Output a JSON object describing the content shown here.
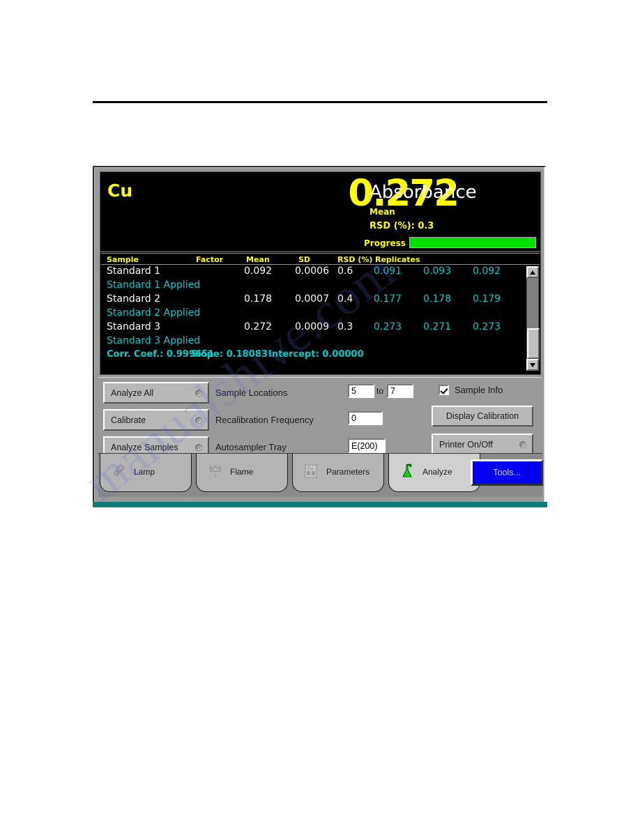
{
  "window": {
    "title": "Analyze"
  },
  "readout": {
    "element": "Cu",
    "value": "0.272",
    "unit": "Absorbance",
    "mean_label": "Mean",
    "rsd_label": "RSD (%): 0.3",
    "progress_label": "Progress",
    "progress_percent": 100,
    "value_color": "#ffff00",
    "unit_color": "#ffffff",
    "progress_color": "#00e000",
    "background_color": "#000000"
  },
  "results_table": {
    "columns": [
      "Sample",
      "Factor",
      "Mean",
      "SD",
      "RSD (%)",
      "Replicates"
    ],
    "header_color": "#ffff00",
    "rule_color": "#00cccc",
    "rows": [
      {
        "type": "data",
        "name": "Standard 1",
        "factor": "",
        "mean": "0.092",
        "sd": "0.0006",
        "rsd": "0.6",
        "replicates": [
          "0.091",
          "0.093",
          "0.092"
        ]
      },
      {
        "type": "status",
        "name": "Standard 1 Applied"
      },
      {
        "type": "data",
        "name": "Standard 2",
        "factor": "",
        "mean": "0.178",
        "sd": "0.0007",
        "rsd": "0.4",
        "replicates": [
          "0.177",
          "0.178",
          "0.179"
        ]
      },
      {
        "type": "status",
        "name": "Standard 2 Applied"
      },
      {
        "type": "data",
        "name": "Standard 3",
        "factor": "",
        "mean": "0.272",
        "sd": "0.0009",
        "rsd": "0.3",
        "replicates": [
          "0.273",
          "0.271",
          "0.273"
        ]
      },
      {
        "type": "status",
        "name": "Standard 3 Applied"
      }
    ],
    "statistics": {
      "corr_coef": "Corr. Coef.: 0.999651",
      "slope": "Slope: 0.18083",
      "intercept": "Intercept: 0.00000"
    }
  },
  "controls": {
    "buttons": [
      {
        "label": "Analyze All"
      },
      {
        "label": "Calibrate"
      },
      {
        "label": "Analyze Samples"
      }
    ],
    "fields": [
      {
        "label": "Sample Locations",
        "from": "5",
        "connector": "to",
        "to": "7"
      },
      {
        "label": "Recalibration Frequency",
        "value": "0"
      },
      {
        "label": "Autosampler Tray",
        "value": "E(200)"
      }
    ],
    "sample_info": {
      "label": "Sample Info",
      "checked": true
    },
    "display_calibration_label": "Display Calibration",
    "printer_label": "Printer On/Off"
  },
  "tabs": [
    {
      "label": "Lamp",
      "icon": "lamp-icon",
      "active": false
    },
    {
      "label": "Flame",
      "icon": "flame-icon",
      "active": false
    },
    {
      "label": "Parameters",
      "icon": "parameters-icon",
      "active": false
    },
    {
      "label": "Analyze",
      "icon": "flask-icon",
      "active": true
    }
  ],
  "tools_button": {
    "label": "Tools...",
    "color": "#0000ee"
  },
  "watermark": {
    "text": "manualshive.com"
  }
}
